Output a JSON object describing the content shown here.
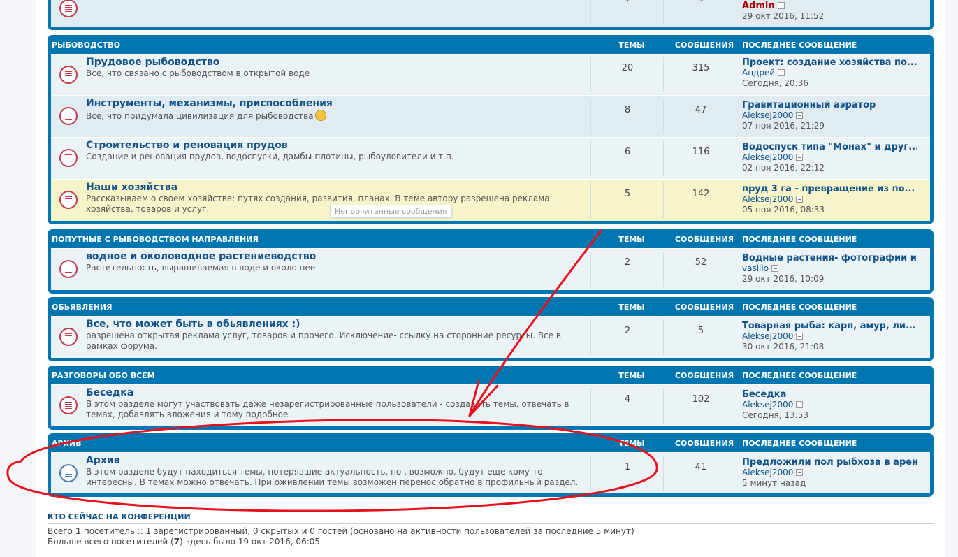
{
  "headers": {
    "topics": "Темы",
    "posts": "Сообщения",
    "last": "Последнее сообщение"
  },
  "top_row": {
    "topics": "1",
    "posts": "5",
    "last_author": "Admin",
    "last_date": "29 окт 2016, 11:52"
  },
  "categories": [
    {
      "title": "Рыбоводство",
      "forums": [
        {
          "title": "Прудовое рыбоводство",
          "desc": "Все, что связано с рыбоводством в открытой воде",
          "topics": "20",
          "posts": "315",
          "last_title": "Проект: создание хозяйства по...",
          "last_author": "Андрей",
          "last_date": "Сегодня, 20:36",
          "state": "unread"
        },
        {
          "title": "Инструменты, механизмы, приспособления",
          "desc": "Все, что придумала цивилизация для рыбоводства",
          "topics": "8",
          "posts": "47",
          "last_title": "Гравитационный аэратор",
          "last_author": "Aleksej2000",
          "last_date": "07 ноя 2016, 21:29",
          "state": "unread"
        },
        {
          "title": "Строительство и реновация прудов",
          "desc": "Создание и реновация прудов, водоспуски, дамбы-плотины, рыбоуловители и т.п.",
          "topics": "6",
          "posts": "116",
          "last_title": "Водоспуск типа \"Монах\" и друг...",
          "last_author": "Aleksej2000",
          "last_date": "02 ноя 2016, 22:12",
          "state": "unread"
        },
        {
          "title": "Наши хозяйства",
          "desc": "Рассказываем о своем хозяйстве: путях создания, развития, планах. В теме автору разрешена реклама хозяйства, товаров и услуг.",
          "topics": "5",
          "posts": "142",
          "last_title": "пруд 3 га - превращение из по...",
          "last_author": "Aleksej2000",
          "last_date": "05 ноя 2016, 08:33",
          "state": "unread"
        }
      ]
    },
    {
      "title": "Попутные с рыбоводством направления",
      "forums": [
        {
          "title": "водное и околоводное растениеводство",
          "desc": "Растительность, выращиваемая в воде и около нее",
          "topics": "2",
          "posts": "52",
          "last_title": "Водные растения- фотографии и...",
          "last_author": "vasilio",
          "last_date": "29 окт 2016, 10:09",
          "state": "unread"
        }
      ]
    },
    {
      "title": "Обьявления",
      "forums": [
        {
          "title": "Все, что может быть в обьявлениях :)",
          "desc": "разрешена открытая реклама услуг, товаров и прочего. Исключение- ссылку на сторонние ресурсы. Все в рамках форума.",
          "topics": "2",
          "posts": "5",
          "last_title": "Товарная рыба: карп, амур, ли...",
          "last_author": "Aleksej2000",
          "last_date": "30 окт 2016, 21:08",
          "state": "unread"
        }
      ]
    },
    {
      "title": "Разговоры обо всем",
      "forums": [
        {
          "title": "Беседка",
          "desc": "В этом разделе могут участвовать даже незарегистрированные пользователи - создавать темы, отвечать в темах, добавлять вложения и тому подобное",
          "topics": "4",
          "posts": "102",
          "last_title": "Беседка",
          "last_author": "Aleksej2000",
          "last_date": "Сегодня, 13:53",
          "state": "unread"
        }
      ]
    },
    {
      "title": "Архив",
      "forums": [
        {
          "title": "Архив",
          "desc": "В этом разделе будут находиться темы, потерявшие актуальность, но , возможно, будут еще кому-то интересны. В темах можно отвечать. При оживлении темы возможен перенос обратно в профильный раздел.",
          "topics": "1",
          "posts": "41",
          "last_title": "Предложили пол рыбхоза в арен...",
          "last_author": "Aleksej2000",
          "last_date": "5 минут назад",
          "state": "read"
        }
      ]
    }
  ],
  "tooltip": "Непрочитанные сообщения",
  "who_online": {
    "title": "Кто сейчас на конференции",
    "line1_pre": "Всего ",
    "line1_num": "1",
    "line1_post": " посетитель :: 1 зарегистрированный, 0 скрытых и 0 гостей (основано на активности пользователей за последние 5 минут)",
    "line2_pre": "Больше всего посетителей (",
    "line2_num": "7",
    "line2_post": ") здесь было 19 окт 2016, 06:05"
  },
  "annotation_color": "#e8101c"
}
